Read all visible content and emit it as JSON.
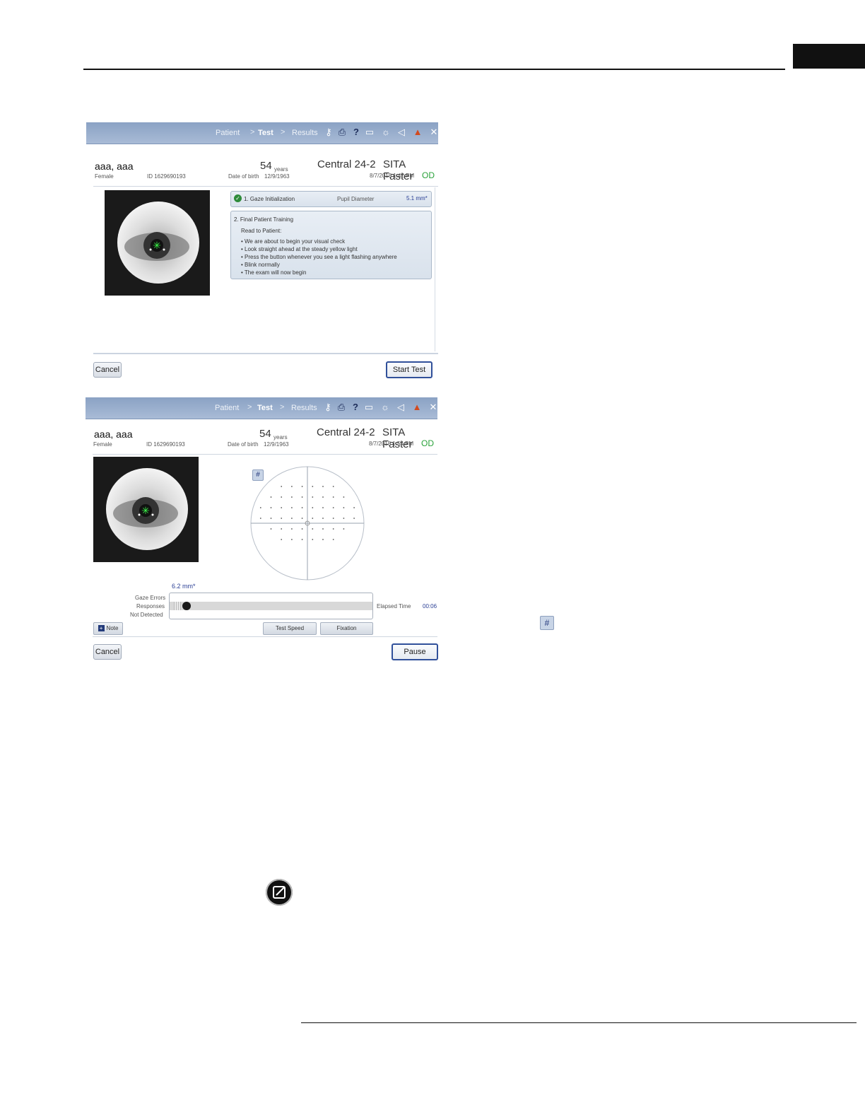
{
  "screen1": {
    "nav": {
      "patient": "Patient",
      "test": "Test",
      "results": "Results",
      "sep": ">"
    },
    "patient": {
      "name": "aaa, aaa",
      "gender": "Female",
      "id": "ID 1629690193",
      "age": "54",
      "age_unit": "years",
      "dob_label": "Date of birth",
      "dob": "12/9/1963"
    },
    "test": {
      "name": "Central 24-2",
      "strategy": "SITA Faster",
      "datetime": "8/7/2018 1:42 PM",
      "eye": "OD"
    },
    "gaze": {
      "step": "1. Gaze Initialization",
      "pupil_label": "Pupil Diameter",
      "pupil_value": "5.1 mm*"
    },
    "training": {
      "title": "2. Final Patient Training",
      "read": "Read to Patient:",
      "bullets": [
        "• We are about to begin your visual check",
        "• Look straight ahead at the steady yellow light",
        "• Press the button whenever you see a light flashing anywhere",
        "• Blink normally",
        "• The exam will now begin"
      ]
    },
    "buttons": {
      "cancel": "Cancel",
      "start": "Start Test"
    }
  },
  "screen2": {
    "nav": {
      "patient": "Patient",
      "test": "Test",
      "results": "Results",
      "sep": ">"
    },
    "patient": {
      "name": "aaa, aaa",
      "gender": "Female",
      "id": "ID 1629690193",
      "age": "54",
      "age_unit": "years",
      "dob_label": "Date of birth",
      "dob": "12/9/1963"
    },
    "test": {
      "name": "Central 24-2",
      "strategy": "SITA Faster",
      "datetime": "8/7/2018 1:54 PM",
      "eye": "OD"
    },
    "pupil_value": "6.2 mm*",
    "labels": {
      "gaze_errors": "Gaze Errors",
      "responses": "Responses",
      "not_detected": "Not Detected",
      "elapsed_label": "Elapsed Time",
      "elapsed": "00:06"
    },
    "buttons": {
      "note": "Note",
      "test_speed": "Test Speed",
      "fixation": "Fixation",
      "cancel": "Cancel",
      "pause": "Pause",
      "hash": "#"
    }
  },
  "side": {
    "hash": "#"
  }
}
